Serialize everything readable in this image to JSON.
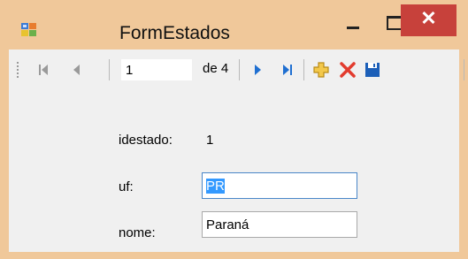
{
  "window": {
    "title": "FormEstados",
    "close_glyph": "✕",
    "titlebar_color": "#f0c89a",
    "close_color": "#c7413b"
  },
  "toolbar": {
    "position_value": "1",
    "count_label": "de 4",
    "icons": [
      "move-first-icon",
      "move-previous-icon",
      "move-next-icon",
      "move-last-icon",
      "add-new-icon",
      "delete-icon",
      "save-icon"
    ]
  },
  "form": {
    "idestado_label": "idestado:",
    "idestado_value": "1",
    "uf_label": "uf:",
    "uf_value": "PR",
    "nome_label": "nome:",
    "nome_value": "Paraná"
  }
}
